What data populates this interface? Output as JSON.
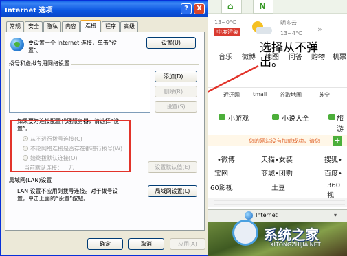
{
  "background": {
    "weather": {
      "temp_today": "13~0°C",
      "city": "明多云",
      "air_quality": "中度污染",
      "temp_tomorrow": "13~4°C",
      "expand": "»"
    },
    "nav_items": [
      "音乐",
      "微博",
      "地图",
      "问答",
      "购物",
      "机票"
    ],
    "overlay_text": "选择从不弹出。",
    "link_row": [
      "近还网",
      "tmall",
      "谷歌地图",
      "苏宁"
    ],
    "green_row": [
      "小游戏",
      "小说大全",
      "旅游"
    ],
    "notice": "您的网站没有加载成功，请您",
    "notice_button": "+",
    "grid": [
      [
        "•微博",
        "天猫•女装",
        "搜狐•"
      ],
      [
        "宝网",
        "商城•团购",
        "百度•"
      ],
      [
        "60影视",
        "土豆",
        "360视"
      ]
    ],
    "status": "Internet",
    "zoom": "▾",
    "watermark_domain": "XITONGZHIJIA.NET",
    "colors": {
      "red_annotation": "#e2332a",
      "title_blue": "#0a5de6"
    }
  },
  "dialog": {
    "title": "Internet 选项",
    "help_label": "?",
    "close_label": "X",
    "tabs": [
      "常规",
      "安全",
      "隐私",
      "内容",
      "连接",
      "程序",
      "高级"
    ],
    "active_tab": "连接",
    "setup_text_1": "要设置一个 Internet 连接，单击“设",
    "setup_text_2": "置”。",
    "setup_button": "设置(U)",
    "dialup_group": "拨号和虚拟专用网络设置",
    "add_button": "添加(D)...",
    "delete_button": "删除(R)...",
    "settings_button": "设置(S)",
    "proxy_text_1": "如果要为连接配置代理服务器，请选择“设",
    "proxy_text_2": "置”。",
    "radios": [
      "从不进行拨号连接(C)",
      "不论网络连接是否存在都进行拨号(W)",
      "始终拨默认连接(O)"
    ],
    "current_default_label": "当前默认连接：",
    "current_default_value": "无",
    "set_default_button": "设置默认值(E)",
    "lan_group": "局域网(LAN)设置",
    "lan_text_1": "LAN 设置不应用到拨号连接。对于拨号设",
    "lan_text_2": "置，单击上面的“设置”按钮。",
    "lan_button": "局域网设置(L)",
    "ok_button": "确定",
    "cancel_button": "取消",
    "apply_button": "应用(A)"
  }
}
